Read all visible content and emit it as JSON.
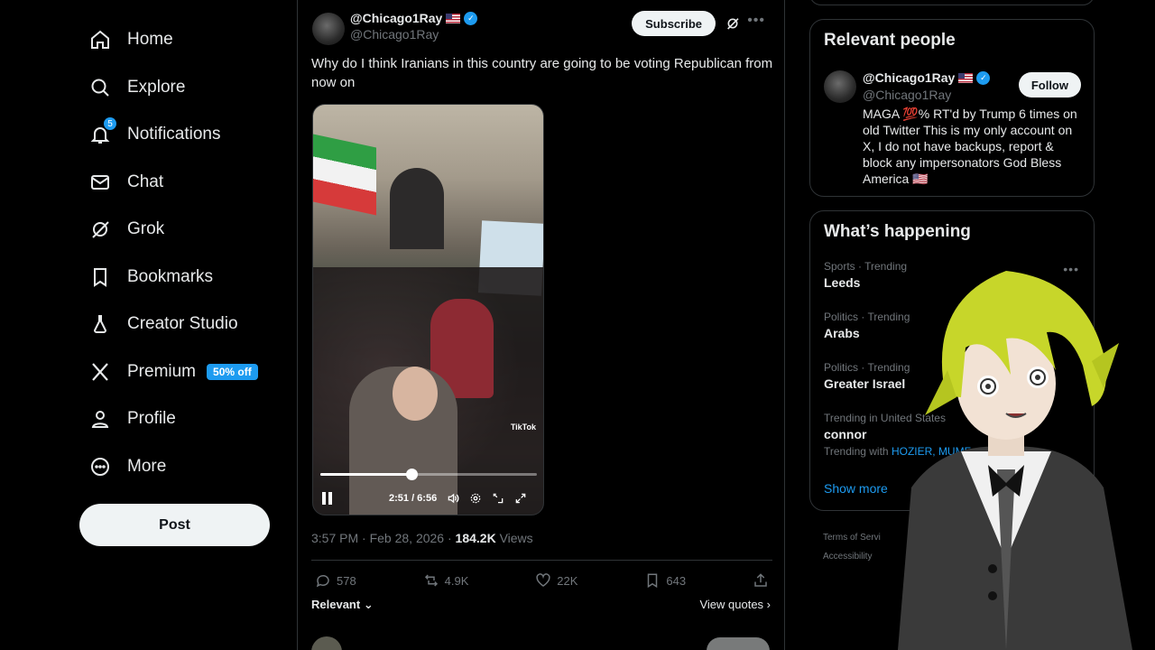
{
  "nav": {
    "items": [
      {
        "label": "Home",
        "icon": "home-icon"
      },
      {
        "label": "Explore",
        "icon": "search-icon"
      },
      {
        "label": "Notifications",
        "icon": "bell-icon",
        "badge": "5"
      },
      {
        "label": "Chat",
        "icon": "mail-icon"
      },
      {
        "label": "Grok",
        "icon": "grok-icon"
      },
      {
        "label": "Bookmarks",
        "icon": "bookmark-icon"
      },
      {
        "label": "Creator Studio",
        "icon": "flask-icon"
      },
      {
        "label": "Premium",
        "icon": "x-logo-icon",
        "promo": "50% off"
      },
      {
        "label": "Profile",
        "icon": "person-icon"
      },
      {
        "label": "More",
        "icon": "more-circle-icon"
      }
    ],
    "post_label": "Post"
  },
  "post": {
    "display_name": "@Chicago1Ray",
    "handle": "@Chicago1Ray",
    "subscribe_label": "Subscribe",
    "text": "Why do I think Iranians in this country are going to be voting Republican from now on",
    "video": {
      "time": "2:51 / 6:56",
      "progress": 0.42,
      "watermark": "TikTok"
    },
    "timestamp": "3:57 PM · Feb 28, 2026 · ",
    "views_count": "184.2K",
    "views_label": " Views",
    "stats": {
      "replies": "578",
      "reposts": "4.9K",
      "likes": "22K",
      "bookmarks": "643"
    },
    "sort_label": "Relevant",
    "view_quotes_label": "View quotes ›"
  },
  "sidebar": {
    "people_title": "Relevant people",
    "person": {
      "display_name": "@Chicago1Ray",
      "handle": "@Chicago1Ray",
      "follow_label": "Follow",
      "bio": "MAGA 💯% RT'd by Trump 6 times on old Twitter This is my only account on X, I do not have backups, report & block any impersonators God Bless America 🇺🇸"
    },
    "trends_title": "What’s happening",
    "trends": [
      {
        "category": "Sports · Trending",
        "topic": "Leeds"
      },
      {
        "category": "Politics · Trending",
        "topic": "Arabs"
      },
      {
        "category": "Politics · Trending",
        "topic": "Greater Israel"
      },
      {
        "category": "Trending in United States",
        "topic": "connor",
        "with_label": "Trending with",
        "with_links": "HOZIER, MUMF"
      }
    ],
    "show_more_label": "Show more",
    "footer": {
      "terms": "Terms of Servi",
      "accessibility": "Accessibility"
    }
  },
  "colors": {
    "accent": "#1d9bf0",
    "background": "#000000",
    "border": "#2f3336",
    "muted_text": "#71767b"
  }
}
